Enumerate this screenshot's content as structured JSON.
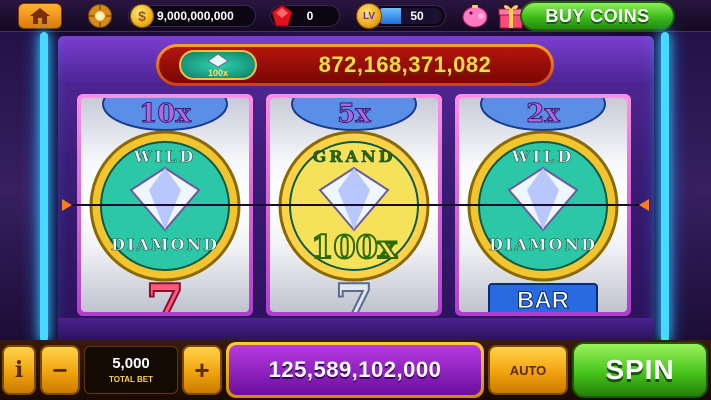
{
  "topbar": {
    "coins": "9,000,000,000",
    "gems": "0",
    "level_badge": "LV",
    "level": "50",
    "level_progress": 0.38,
    "buy_coins_label": "BUY COINS",
    "coin_symbol": "$"
  },
  "jackpot": {
    "badge_text": "100x",
    "value": "872,168,371,082"
  },
  "reels": [
    {
      "top_multiplier": "10x",
      "center_symbol": "WILD DIAMOND",
      "center_top": "WILD",
      "center_bottom": "DIAMOND",
      "bottom_symbol": "7"
    },
    {
      "top_multiplier": "5x",
      "center_symbol": "GRAND DIAMOND 100x",
      "center_top": "GRAND",
      "center_bottom": "100x",
      "bottom_symbol": "7"
    },
    {
      "top_multiplier": "2x",
      "center_symbol": "WILD DIAMOND",
      "center_top": "WILD",
      "center_bottom": "DIAMOND",
      "bottom_symbol": "BAR"
    }
  ],
  "bottombar": {
    "info_label": "i",
    "minus_label": "−",
    "plus_label": "+",
    "total_bet": "5,000",
    "total_bet_label": "TOTAL BET",
    "win_amount": "125,589,102,000",
    "auto_label": "AUTO",
    "spin_label": "SPIN"
  },
  "colors": {
    "neon": "#49d8ff",
    "spin_green": "#47c51c",
    "gold": "#f0a30e",
    "jackpot_red": "#b3160c",
    "win_purple": "#9a2ad0"
  }
}
